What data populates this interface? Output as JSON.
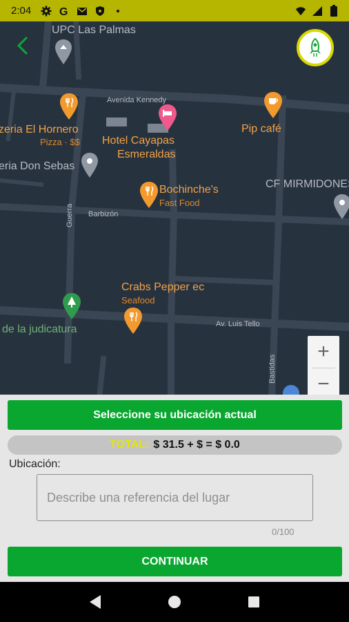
{
  "status_bar": {
    "time": "2:04",
    "icons": [
      "gear-icon",
      "google-icon",
      "gmail-icon",
      "shield-icon",
      "dot-icon"
    ],
    "right_icons": [
      "wifi-icon",
      "signal-icon",
      "battery-icon"
    ]
  },
  "map": {
    "pois": {
      "upc": "UPC Las Palmas",
      "hornero": "zeria El Hornero",
      "hornero_sub": "Pizza · $$",
      "hotel_line1": "Hotel Cayapas",
      "hotel_line2": "Esmeraldas",
      "pip": "Pip café",
      "don_sebas": "eria Don Sebas",
      "bochinche": "Bochinche's",
      "bochinche_sub": "Fast Food",
      "mirmidones": "CF MIRMIDONES",
      "crabs": "Crabs Pepper ec",
      "crabs_sub": "Seafood",
      "judicatura": "de la judicatura"
    },
    "streets": {
      "kennedy": "Avenida Kennedy",
      "barbizon": "Barbizón",
      "guerra": "Guerra",
      "luis_tello": "Av. Luis Tello",
      "bastidas": "Bastidas"
    },
    "zoom_in": "+",
    "zoom_out": "−",
    "colors": {
      "background": "#27323f",
      "road": "#3b4654",
      "poi": "#f2a347"
    }
  },
  "sheet": {
    "select_location_label": "Seleccione su ubicación actual",
    "total_label": "TOTAL:",
    "total_value": "$ 31.5 + $  = $ 0.0",
    "location_label": "Ubicación:",
    "reference_placeholder": "Describe una referencia del lugar",
    "char_count": "0/100",
    "continue_label": "CONTINUAR",
    "colors": {
      "button": "#09a730",
      "total_label": "#e6e600"
    }
  }
}
